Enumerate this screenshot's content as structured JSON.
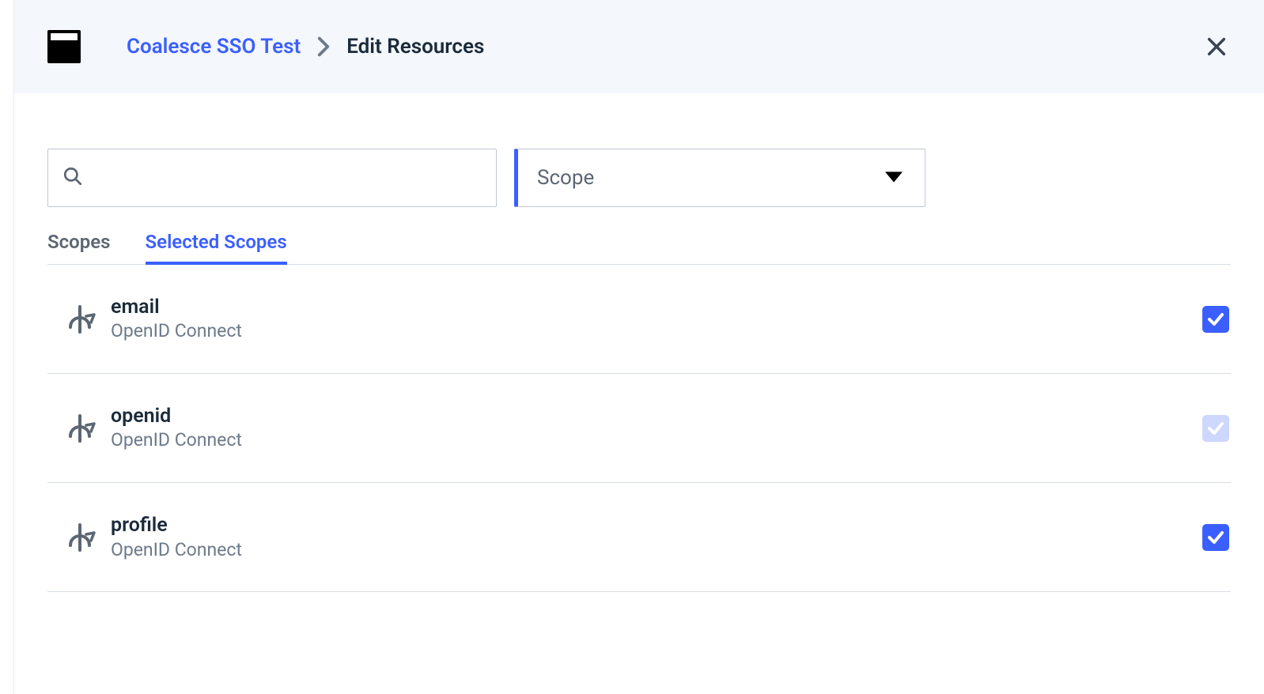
{
  "header": {
    "breadcrumb_link": "Coalesce SSO Test",
    "breadcrumb_current": "Edit Resources"
  },
  "controls": {
    "search_value": "",
    "dropdown_label": "Scope"
  },
  "tabs": [
    {
      "label": "Scopes",
      "active": false
    },
    {
      "label": "Selected Scopes",
      "active": true
    }
  ],
  "scopes": [
    {
      "name": "email",
      "provider": "OpenID Connect",
      "checked": true,
      "disabled": false
    },
    {
      "name": "openid",
      "provider": "OpenID Connect",
      "checked": true,
      "disabled": true
    },
    {
      "name": "profile",
      "provider": "OpenID Connect",
      "checked": true,
      "disabled": false
    }
  ]
}
